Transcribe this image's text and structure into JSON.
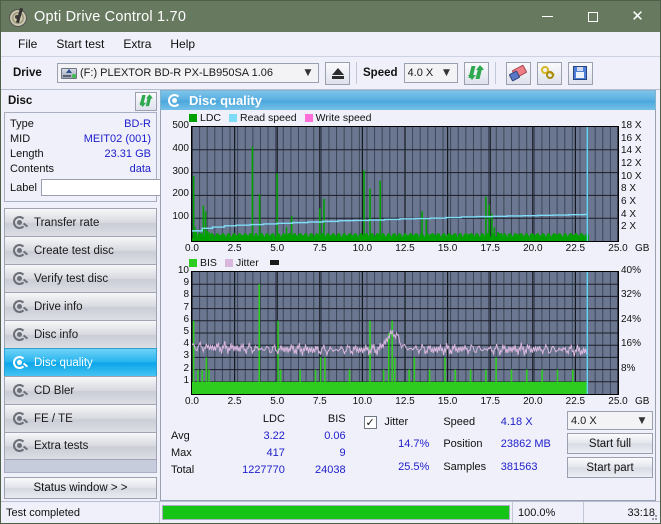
{
  "window": {
    "title": "Opti Drive Control 1.70",
    "app_icon": "disc-pen-icon",
    "titlebar_color": "#67795f",
    "minimize_label": "–",
    "maximize_label": "□",
    "close_label": "✕"
  },
  "menu": {
    "items": [
      {
        "label": "File"
      },
      {
        "label": "Start test"
      },
      {
        "label": "Extra"
      },
      {
        "label": "Help"
      }
    ]
  },
  "toolbar": {
    "drive_label": "Drive",
    "drive_value": "(F:)   PLEXTOR BD-R  PX-LB950SA 1.06",
    "eject_label": "eject",
    "speed_label": "Speed",
    "speed_value": "4.0 X",
    "refresh_label": "refresh",
    "erase_label": "erase",
    "keys_label": "keys",
    "save_label": "save"
  },
  "disc_panel": {
    "header": "Disc",
    "refresh_label": "refresh",
    "rows": [
      {
        "key": "Type",
        "value": "BD-R"
      },
      {
        "key": "MID",
        "value": "MEIT02 (001)"
      },
      {
        "key": "Length",
        "value": "23.31 GB"
      },
      {
        "key": "Contents",
        "value": "data"
      }
    ],
    "label_key": "Label",
    "label_value": "",
    "label_placeholder": ""
  },
  "nav": {
    "items": [
      {
        "label": "Transfer rate",
        "active": false
      },
      {
        "label": "Create test disc",
        "active": false
      },
      {
        "label": "Verify test disc",
        "active": false
      },
      {
        "label": "Drive info",
        "active": false
      },
      {
        "label": "Disc info",
        "active": false
      },
      {
        "label": "Disc quality",
        "active": true
      },
      {
        "label": "CD Bler",
        "active": false
      },
      {
        "label": "FE / TE",
        "active": false
      },
      {
        "label": "Extra tests",
        "active": false
      }
    ],
    "status_window_label": "Status window > >"
  },
  "panel": {
    "title": "Disc quality",
    "colors": {
      "ldc": "#00a000",
      "bis": "#2ecc1f",
      "read_speed": "#7fdcf7",
      "write_speed": "#ff6ed8",
      "jitter": "#d9b6de",
      "plot_bg": "#6b7790",
      "accent": "#4aa6dc",
      "progress": "#15c415"
    }
  },
  "stats": {
    "col_headers": [
      "LDC",
      "BIS"
    ],
    "rows": [
      {
        "key": "Avg",
        "ldc": "3.22",
        "bis": "0.06"
      },
      {
        "key": "Max",
        "ldc": "417",
        "bis": "9"
      },
      {
        "key": "Total",
        "ldc": "1227770",
        "bis": "24038"
      }
    ],
    "jitter_checkbox": {
      "label": "Jitter",
      "checked": true,
      "mark": "✓"
    },
    "jitter_values": [
      "14.7%",
      "25.5%"
    ],
    "right_rows": [
      {
        "key": "Speed",
        "value": "4.18 X"
      },
      {
        "key": "Position",
        "value": "23862 MB"
      },
      {
        "key": "Samples",
        "value": "381563"
      }
    ],
    "speed_select": "4.0 X",
    "start_full_label": "Start full",
    "start_part_label": "Start part"
  },
  "statusbar": {
    "message": "Test completed",
    "percent_label": "100.0%",
    "percent_value": 100,
    "time": "33:18"
  },
  "chart_data": [
    {
      "id": "ldc-chart",
      "type": "line",
      "title": "Disc quality - LDC / Read speed",
      "legend": [
        {
          "label": "LDC",
          "color": "#00a000"
        },
        {
          "label": "Read speed",
          "color": "#7fdcf7"
        },
        {
          "label": "Write speed",
          "color": "#ff6ed8"
        }
      ],
      "legend_position": "top",
      "grid": true,
      "xlabel": "GB",
      "xlim": [
        0,
        25.0
      ],
      "xticks": [
        "0.0",
        "2.5",
        "5.0",
        "7.5",
        "10.0",
        "12.5",
        "15.0",
        "17.5",
        "20.0",
        "22.5",
        "25.0"
      ],
      "xtick_values": [
        0,
        2.5,
        5,
        7.5,
        10,
        12.5,
        15,
        17.5,
        20,
        22.5,
        25
      ],
      "ylabel_left": "LDC",
      "ylim_left": [
        0,
        500
      ],
      "yticks_left": [
        "100",
        "200",
        "300",
        "400",
        "500"
      ],
      "ytick_values_left": [
        100,
        200,
        300,
        400,
        500
      ],
      "ylabel_right": "Speed",
      "ylim_right": [
        0,
        18
      ],
      "yticks_right": [
        "2 X",
        "4 X",
        "6 X",
        "8 X",
        "10 X",
        "12 X",
        "14 X",
        "16 X",
        "18 X"
      ],
      "ytick_values_right": [
        2,
        4,
        6,
        8,
        10,
        12,
        14,
        16,
        18
      ],
      "series": [
        {
          "name": "LDC",
          "color": "#00a000",
          "kind": "spikes",
          "x": [
            0.05,
            0.12,
            0.2,
            0.35,
            0.5,
            0.62,
            0.75,
            0.85,
            0.95,
            1.05,
            1.2,
            1.4,
            1.6,
            1.85,
            2.1,
            2.35,
            2.6,
            2.9,
            3.2,
            3.5,
            3.75,
            3.92,
            4.1,
            4.3,
            4.5,
            4.7,
            4.95,
            5.08,
            5.25,
            5.5,
            5.8,
            6.0,
            6.2,
            6.45,
            6.7,
            6.95,
            7.2,
            7.45,
            7.55,
            7.7,
            7.9,
            8.1,
            8.35,
            8.6,
            8.85,
            9.1,
            9.35,
            9.6,
            9.85,
            10.05,
            10.2,
            10.4,
            10.6,
            10.85,
            11.0,
            11.2,
            11.45,
            11.7,
            11.9,
            12.05,
            12.2,
            12.4,
            12.6,
            12.75,
            12.95,
            13.2,
            13.45,
            13.7,
            13.95,
            14.2,
            14.45,
            14.7,
            14.95,
            15.2,
            15.45,
            15.7,
            15.95,
            16.2,
            16.45,
            16.7,
            16.95,
            17.2,
            17.4,
            17.55,
            17.7,
            17.9,
            18.1,
            18.35,
            18.6,
            18.85,
            19.1,
            19.35,
            19.6,
            19.85,
            20.1,
            20.35,
            20.6,
            20.85,
            21.1,
            21.35,
            21.6,
            21.85,
            22.1,
            22.35,
            22.6,
            22.85,
            23.05,
            23.2
          ],
          "values": [
            285,
            60,
            40,
            35,
            30,
            155,
            130,
            45,
            38,
            32,
            30,
            28,
            26,
            25,
            24,
            26,
            25,
            24,
            26,
            415,
            30,
            205,
            28,
            26,
            25,
            24,
            297,
            26,
            25,
            60,
            110,
            28,
            26,
            25,
            24,
            26,
            25,
            143,
            24,
            185,
            26,
            25,
            24,
            26,
            25,
            24,
            26,
            25,
            24,
            310,
            26,
            230,
            25,
            24,
            265,
            26,
            25,
            24,
            26,
            25,
            24,
            26,
            25,
            24,
            26,
            28,
            130,
            95,
            30,
            28,
            26,
            30,
            28,
            26,
            30,
            28,
            26,
            30,
            28,
            26,
            30,
            195,
            160,
            120,
            60,
            40,
            35,
            30,
            28,
            26,
            30,
            28,
            26,
            30,
            28,
            26,
            30,
            28,
            26,
            30,
            28,
            26,
            30,
            28,
            26,
            30,
            28,
            26
          ],
          "note": "LDC error spikes across the disc; baseline near 20-40, major peaks at 3.9GB (415), 10.05GB (310), 4.95GB (297), 0.05GB (285), 10.4GB (230)"
        },
        {
          "name": "Read speed",
          "color": "#7fdcf7",
          "kind": "step-line",
          "x": [
            0.0,
            0.6,
            1.2,
            1.9,
            2.6,
            3.4,
            4.2,
            5.0,
            5.9,
            6.8,
            7.7,
            8.6,
            9.5,
            10.4,
            11.3,
            12.2,
            13.1,
            14.0,
            14.9,
            15.8,
            16.7,
            17.6,
            18.5,
            19.4,
            20.3,
            21.2,
            22.1,
            23.0,
            23.2
          ],
          "values": [
            1.6,
            2.0,
            2.2,
            2.4,
            2.5,
            2.6,
            2.7,
            2.8,
            2.9,
            3.0,
            3.1,
            3.2,
            3.25,
            3.3,
            3.4,
            3.5,
            3.55,
            3.6,
            3.7,
            3.8,
            3.85,
            3.9,
            3.95,
            4.0,
            4.05,
            4.1,
            4.15,
            4.2,
            4.2
          ],
          "unit": "X",
          "note": "Read speed ramps from about 1.6X to 4.2X (CAV), ends at 23.2GB"
        },
        {
          "name": "Write speed",
          "color": "#ff6ed8",
          "kind": "step-line",
          "x": [],
          "values": [],
          "note": "not plotted"
        }
      ]
    },
    {
      "id": "bis-chart",
      "type": "line",
      "title": "Disc quality - BIS / Jitter",
      "legend": [
        {
          "label": "BIS",
          "color": "#2ecc1f"
        },
        {
          "label": "Jitter",
          "color": "#d9b6de"
        }
      ],
      "legend_position": "top",
      "grid": true,
      "xlabel": "GB",
      "xlim": [
        0,
        25.0
      ],
      "xticks": [
        "0.0",
        "2.5",
        "5.0",
        "7.5",
        "10.0",
        "12.5",
        "15.0",
        "17.5",
        "20.0",
        "22.5",
        "25.0"
      ],
      "xtick_values": [
        0,
        2.5,
        5,
        7.5,
        10,
        12.5,
        15,
        17.5,
        20,
        22.5,
        25
      ],
      "ylabel_left": "BIS",
      "ylim_left": [
        0,
        10
      ],
      "yticks_left": [
        "1",
        "2",
        "3",
        "4",
        "5",
        "6",
        "7",
        "8",
        "9",
        "10"
      ],
      "ytick_values_left": [
        1,
        2,
        3,
        4,
        5,
        6,
        7,
        8,
        9,
        10
      ],
      "ylabel_right": "Jitter",
      "ylim_right": [
        0,
        40
      ],
      "yticks_right": [
        "8%",
        "16%",
        "24%",
        "32%",
        "40%"
      ],
      "ytick_values_right": [
        8,
        16,
        24,
        32,
        40
      ],
      "series": [
        {
          "name": "BIS",
          "color": "#2ecc1f",
          "kind": "spikes",
          "baseline": 1,
          "x": [
            0.05,
            0.3,
            0.55,
            0.8,
            0.95,
            1.3,
            1.7,
            2.1,
            2.5,
            2.9,
            3.3,
            3.6,
            3.9,
            4.2,
            4.6,
            5.0,
            5.15,
            5.5,
            5.9,
            6.3,
            6.6,
            6.9,
            7.2,
            7.5,
            7.75,
            8.0,
            8.3,
            8.6,
            8.9,
            9.2,
            9.5,
            9.8,
            10.1,
            10.4,
            10.6,
            10.9,
            11.2,
            11.5,
            11.7,
            11.85,
            12.1,
            12.4,
            12.7,
            13.0,
            13.3,
            13.6,
            13.9,
            14.2,
            14.5,
            14.8,
            15.1,
            15.4,
            15.7,
            16.0,
            16.3,
            16.6,
            16.9,
            17.2,
            17.5,
            17.8,
            18.1,
            18.4,
            18.7,
            19.0,
            19.3,
            19.6,
            19.9,
            20.2,
            20.5,
            20.8,
            21.1,
            21.4,
            21.7,
            22.0,
            22.3,
            22.6,
            22.9,
            23.1
          ],
          "values": [
            6,
            2,
            2,
            3,
            2,
            1,
            1,
            1,
            1,
            1,
            1,
            1,
            9,
            1,
            1,
            6,
            2,
            1,
            1,
            2,
            1,
            1,
            2,
            3,
            3,
            1,
            1,
            1,
            1,
            2,
            1,
            1,
            1,
            6,
            1,
            1,
            2,
            5,
            6,
            3,
            1,
            1,
            2,
            3,
            1,
            1,
            2,
            1,
            1,
            3,
            1,
            2,
            1,
            1,
            2,
            1,
            1,
            2,
            1,
            3,
            1,
            1,
            2,
            1,
            1,
            2,
            1,
            1,
            2,
            1,
            1,
            2,
            1,
            1,
            2,
            1,
            1,
            1
          ],
          "note": "BIS mostly at or below 1 (solid green floor band); peaks of 9 at 3.9GB, 6 at 0.05/5.0/10.4/11.7GB, 5 at 11.5GB"
        },
        {
          "name": "Jitter",
          "color": "#d9b6de",
          "kind": "line",
          "x": [
            0.0,
            1.0,
            2.0,
            3.0,
            4.0,
            5.0,
            6.0,
            7.0,
            8.0,
            9.0,
            10.0,
            11.0,
            11.8,
            12.5,
            14.0,
            16.0,
            18.0,
            20.0,
            22.0,
            23.2
          ],
          "values": [
            15.5,
            15.3,
            15.2,
            15.0,
            14.8,
            14.6,
            14.8,
            14.5,
            14.4,
            14.6,
            14.5,
            14.7,
            20.5,
            15.0,
            14.6,
            14.8,
            14.6,
            14.7,
            14.5,
            14.0
          ],
          "unit": "%",
          "avg": "14.7%",
          "max": "25.5%",
          "note": "Jitter noise band hovering near 14-16% (≈3.7 on the 0-10 left scale) with a spike near 11.8GB"
        }
      ]
    }
  ]
}
